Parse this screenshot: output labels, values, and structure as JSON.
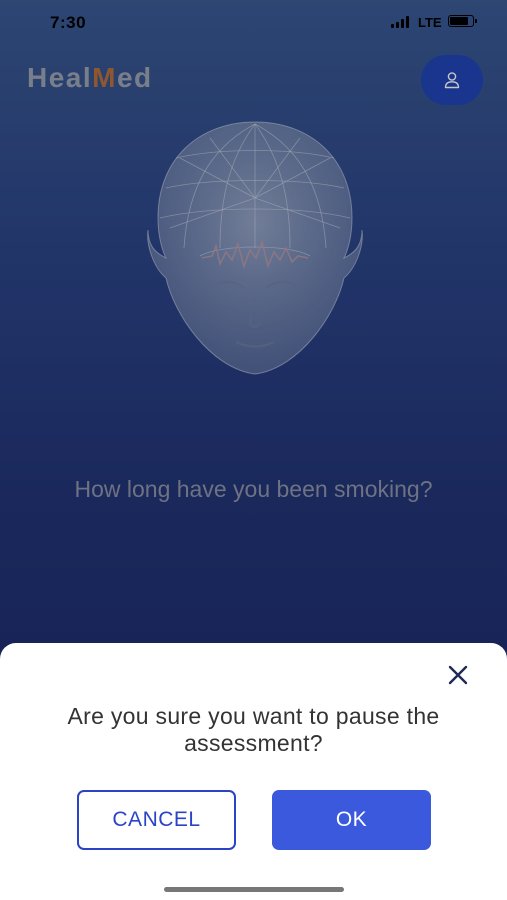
{
  "status_bar": {
    "time": "7:30",
    "network": "LTE",
    "signal_icon": "cellular-signal-icon",
    "battery_icon": "battery-icon",
    "battery_level": 0.85
  },
  "header": {
    "logo_text_a": "Heal",
    "logo_text_b": "M",
    "logo_text_c": "ed",
    "profile_icon": "user-icon"
  },
  "main": {
    "illustration": "wireframe-head-icon",
    "question": "How long have you been smoking?"
  },
  "dialog": {
    "close_icon": "close-icon",
    "message": "Are you sure you want to pause the assessment?",
    "cancel_label": "CANCEL",
    "ok_label": "OK"
  },
  "colors": {
    "primary": "#3b59dd",
    "outline": "#2b44c7",
    "logo_accent": "#b8703e"
  }
}
